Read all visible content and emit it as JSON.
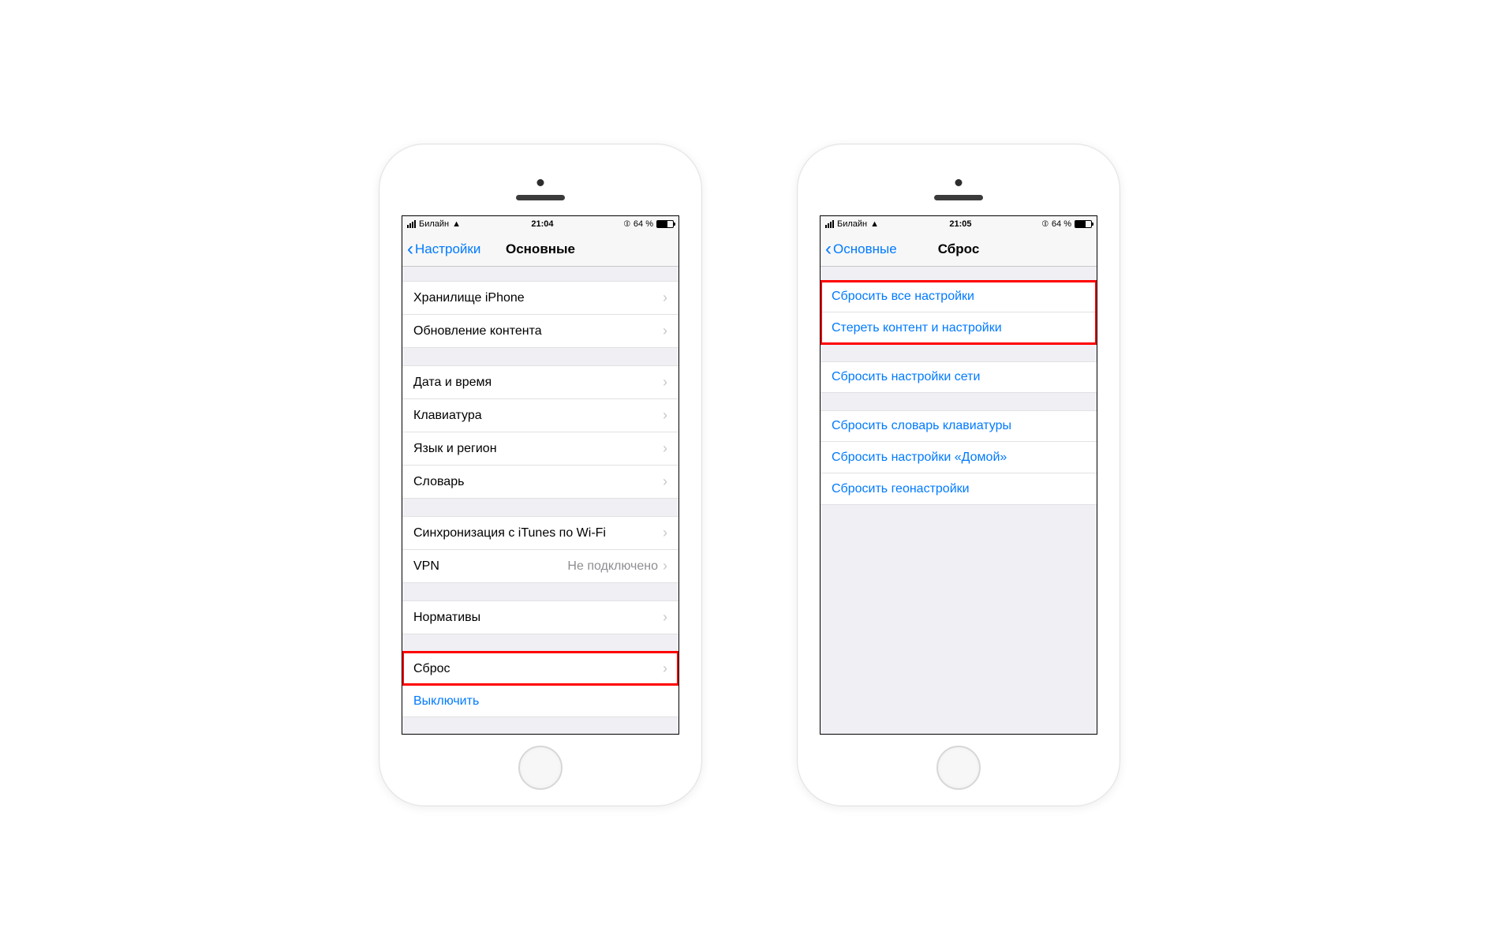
{
  "phone1": {
    "status": {
      "carrier": "Билайн",
      "time": "21:04",
      "battery_pct": "64 %"
    },
    "nav": {
      "back_label": "Настройки",
      "title": "Основные"
    },
    "groups": [
      {
        "cells": [
          {
            "label": "Хранилище iPhone",
            "chevron": true
          },
          {
            "label": "Обновление контента",
            "chevron": true
          }
        ]
      },
      {
        "cells": [
          {
            "label": "Дата и время",
            "chevron": true
          },
          {
            "label": "Клавиатура",
            "chevron": true
          },
          {
            "label": "Язык и регион",
            "chevron": true
          },
          {
            "label": "Словарь",
            "chevron": true
          }
        ]
      },
      {
        "cells": [
          {
            "label": "Синхронизация с iTunes по Wi-Fi",
            "chevron": true
          },
          {
            "label": "VPN",
            "detail": "Не подключено",
            "chevron": true
          }
        ]
      },
      {
        "cells": [
          {
            "label": "Нормативы",
            "chevron": true
          }
        ]
      },
      {
        "cells": [
          {
            "label": "Сброс",
            "chevron": true,
            "highlighted": true
          },
          {
            "label": "Выключить",
            "link": true
          }
        ]
      }
    ]
  },
  "phone2": {
    "status": {
      "carrier": "Билайн",
      "time": "21:05",
      "battery_pct": "64 %"
    },
    "nav": {
      "back_label": "Основные",
      "title": "Сброс"
    },
    "groups": [
      {
        "highlighted": true,
        "cells": [
          {
            "label": "Сбросить все настройки",
            "link": true
          },
          {
            "label": "Стереть контент и настройки",
            "link": true
          }
        ]
      },
      {
        "cells": [
          {
            "label": "Сбросить настройки сети",
            "link": true
          }
        ]
      },
      {
        "cells": [
          {
            "label": "Сбросить словарь клавиатуры",
            "link": true
          },
          {
            "label": "Сбросить настройки «Домой»",
            "link": true
          },
          {
            "label": "Сбросить геонастройки",
            "link": true
          }
        ]
      }
    ]
  }
}
